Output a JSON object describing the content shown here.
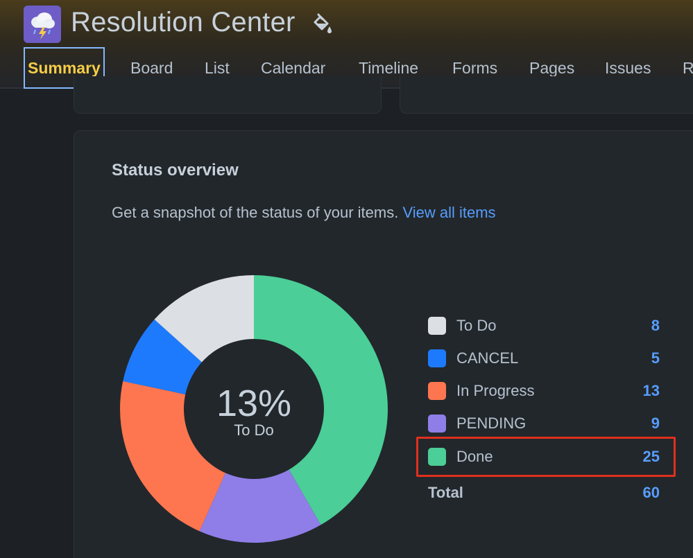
{
  "app": {
    "title": "Resolution Center",
    "icon": "storm-cloud-icon"
  },
  "tabs": [
    {
      "label": "Summary",
      "active": true
    },
    {
      "label": "Board"
    },
    {
      "label": "List"
    },
    {
      "label": "Calendar"
    },
    {
      "label": "Timeline"
    },
    {
      "label": "Forms"
    },
    {
      "label": "Pages"
    },
    {
      "label": "Issues"
    },
    {
      "label": "R"
    }
  ],
  "status_overview": {
    "title": "Status overview",
    "description": "Get a snapshot of the status of your items.",
    "link": "View all items",
    "center_percent": "13%",
    "center_label": "To Do",
    "legend": [
      {
        "label": "To Do",
        "count": "8",
        "color": "#dcdfe4"
      },
      {
        "label": "CANCEL",
        "count": "5",
        "color": "#1d7afc"
      },
      {
        "label": "In Progress",
        "count": "13",
        "color": "#fd7650"
      },
      {
        "label": "PENDING",
        "count": "9",
        "color": "#8f7ee7"
      },
      {
        "label": "Done",
        "count": "25",
        "color": "#4bce97"
      }
    ],
    "total_label": "Total",
    "total_count": "60"
  },
  "chart_data": {
    "type": "pie",
    "categories": [
      "Done",
      "PENDING",
      "In Progress",
      "CANCEL",
      "To Do"
    ],
    "values": [
      25,
      9,
      13,
      5,
      8
    ],
    "colors": [
      "#4bce97",
      "#8f7ee7",
      "#fd7650",
      "#1d7afc",
      "#dcdfe4"
    ],
    "donut": true
  },
  "colors": {
    "accent": "#579dff",
    "active_tab": "#f5cd47",
    "highlight": "#e0301e"
  }
}
